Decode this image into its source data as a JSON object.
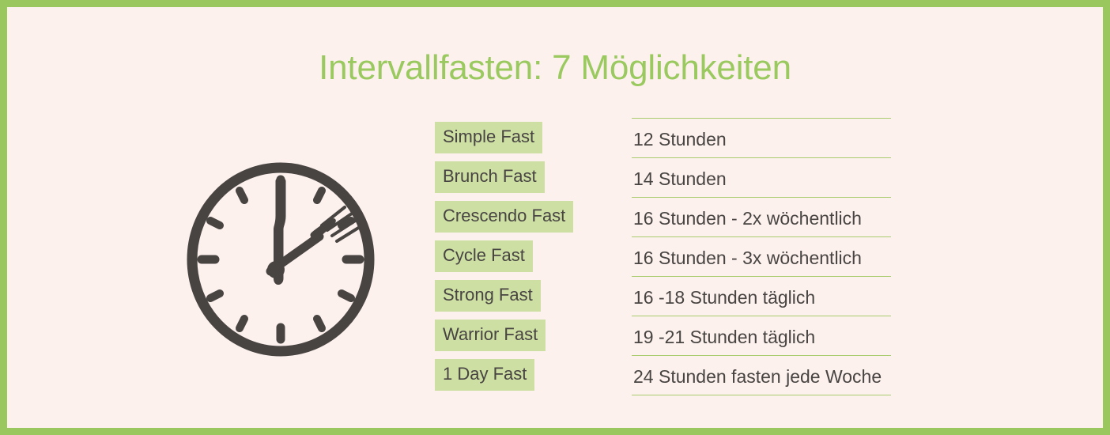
{
  "title": "Intervallfasten: 7 Möglichkeiten",
  "colors": {
    "border_green": "#9ac85f",
    "title_green": "#9ac95f",
    "pill_green": "#cedfa4",
    "rule_green": "#a9cc6e",
    "background_cream": "#fdf1ed",
    "text_dark": "#474442"
  },
  "illustration": {
    "name": "clock-with-knife-and-fork",
    "knife_position": "12 o'clock",
    "fork_position": "1:30"
  },
  "table": {
    "rows": [
      {
        "label": "Simple Fast",
        "value": "12 Stunden"
      },
      {
        "label": "Brunch Fast",
        "value": "14 Stunden"
      },
      {
        "label": "Crescendo Fast",
        "value": "16 Stunden - 2x wöchentlich"
      },
      {
        "label": "Cycle Fast",
        "value": "16 Stunden - 3x wöchentlich"
      },
      {
        "label": "Strong Fast",
        "value": "16 -18 Stunden täglich"
      },
      {
        "label": "Warrior Fast",
        "value": "19 -21 Stunden täglich"
      },
      {
        "label": "1 Day Fast",
        "value": "24 Stunden fasten jede Woche"
      }
    ]
  }
}
